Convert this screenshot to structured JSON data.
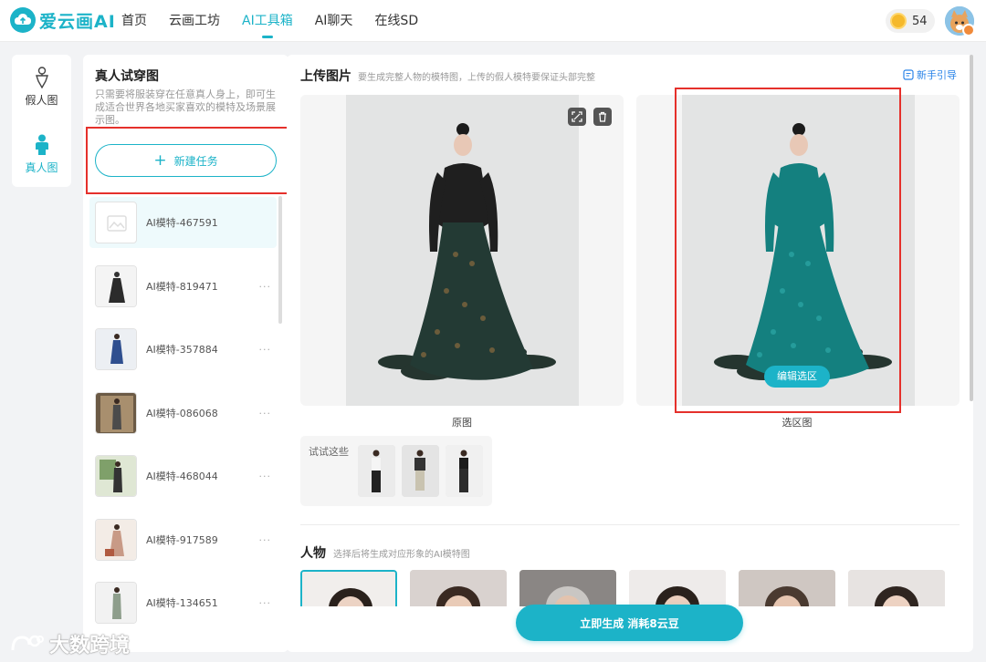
{
  "app": {
    "name": "爱云画AI"
  },
  "nav": [
    "首页",
    "云画工坊",
    "AI工具箱",
    "AI聊天",
    "在线SD"
  ],
  "nav_active": "AI工具箱",
  "coins": "54",
  "rail": [
    "假人图",
    "真人图"
  ],
  "rail_active": "真人图",
  "panel": {
    "title": "真人试穿图",
    "description": "只需要将服装穿在任意真人身上，即可生成适合世界各地买家喜欢的模特及场景展示图。",
    "new_task": "新建任务",
    "more": "···"
  },
  "tasks": [
    {
      "name": "AI模特-467591",
      "selected": true
    },
    {
      "name": "AI模特-819471"
    },
    {
      "name": "AI模特-357884"
    },
    {
      "name": "AI模特-086068"
    },
    {
      "name": "AI模特-468044"
    },
    {
      "name": "AI模特-917589"
    },
    {
      "name": "AI模特-134651"
    }
  ],
  "upload": {
    "title": "上传图片",
    "note": "要生成完整人物的模特图，上传的假人模特要保证头部完整",
    "guide": "新手引导",
    "original_caption": "原图",
    "selection_caption": "选区图",
    "edit_selection": "编辑选区",
    "try_label": "试试这些"
  },
  "person": {
    "title": "人物",
    "note": "选择后将生成对应形象的AI模特图"
  },
  "generate": "立即生成  消耗8云豆",
  "watermark": "大数跨境",
  "colors": {
    "accent": "#1cb3c8",
    "highlight_box": "#e5302b",
    "link": "#2a84e8"
  }
}
